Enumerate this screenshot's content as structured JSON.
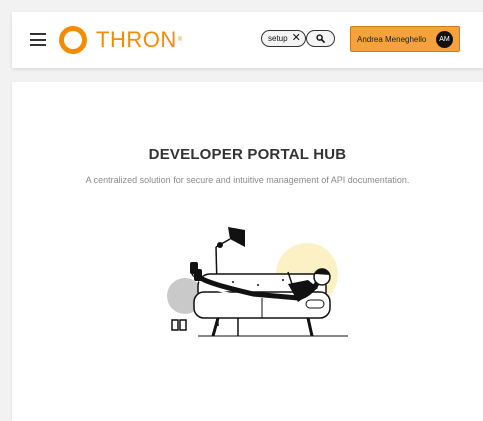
{
  "header": {
    "menu_icon": "hamburger-menu-icon",
    "logo_text": "THRON",
    "logo_mark": "®",
    "brand_color": "#f28c00",
    "filter_chip": {
      "label": "setup",
      "remove_icon": "close-icon"
    },
    "search_icon": "search-icon",
    "user": {
      "name": "Andrea Meneghello",
      "initials": "AM",
      "button_color": "#f5a13c"
    }
  },
  "main": {
    "title": "DEVELOPER PORTAL HUB",
    "subtitle": "A centralized solution for secure and intuitive management of API documentation.",
    "illustration": "person-relaxing-on-sofa-illustration"
  }
}
